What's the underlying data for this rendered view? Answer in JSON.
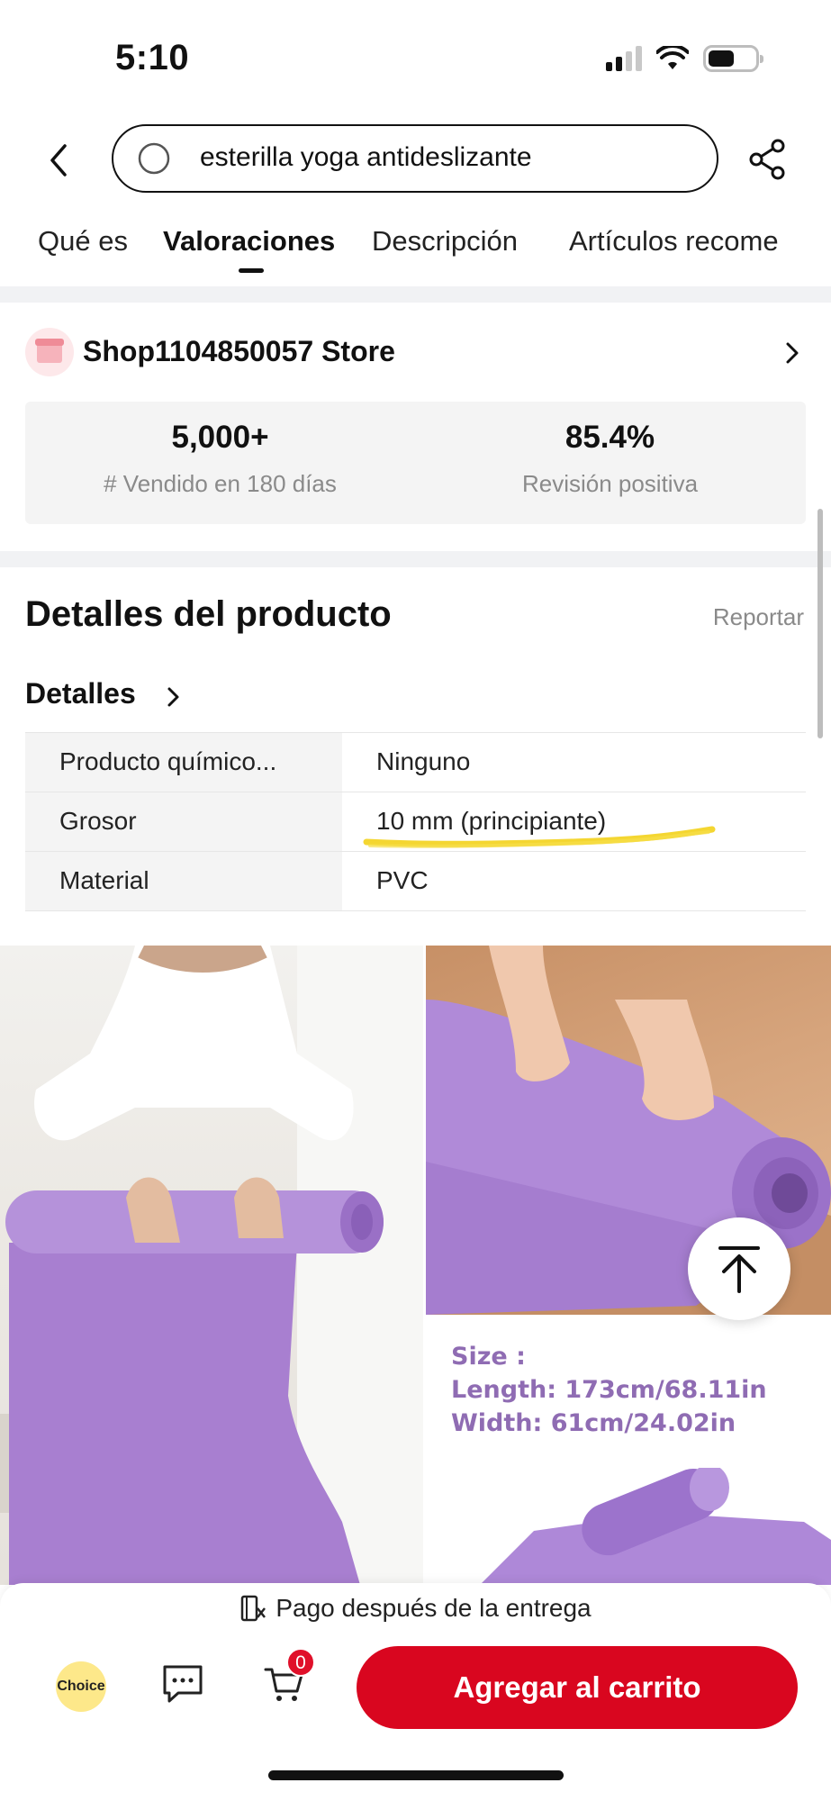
{
  "status_bar": {
    "time": "5:10"
  },
  "search": {
    "query": "esterilla yoga antideslizante"
  },
  "tabs": [
    {
      "label": "Qué es"
    },
    {
      "label": "Valoraciones"
    },
    {
      "label": "Descripción"
    },
    {
      "label": "Artículos recome"
    }
  ],
  "store": {
    "name": "Shop1104850057 Store",
    "stats": [
      {
        "value": "5,000+",
        "label": "# Vendido en 180 días"
      },
      {
        "value": "85.4%",
        "label": "Revisión positiva"
      }
    ]
  },
  "details": {
    "title": "Detalles del producto",
    "report_label": "Reportar",
    "section_label": "Detalles",
    "specs": [
      {
        "key": "Producto químico...",
        "value": "Ninguno"
      },
      {
        "key": "Grosor",
        "value": "10 mm (principiante)"
      },
      {
        "key": "Material",
        "value": "PVC"
      }
    ]
  },
  "product_image": {
    "size_title": "Size :",
    "length": "Length: 173cm/68.11in",
    "width": "Width: 61cm/24.02in"
  },
  "bottom_bar": {
    "pay_note": "Pago después de la entrega",
    "choice_label": "Choice",
    "cart_count": "0",
    "add_to_cart_label": "Agregar al carrito"
  },
  "colors": {
    "accent": "#d9061f",
    "highlight": "#f3d21b",
    "mat_purple": "#a883cf"
  }
}
